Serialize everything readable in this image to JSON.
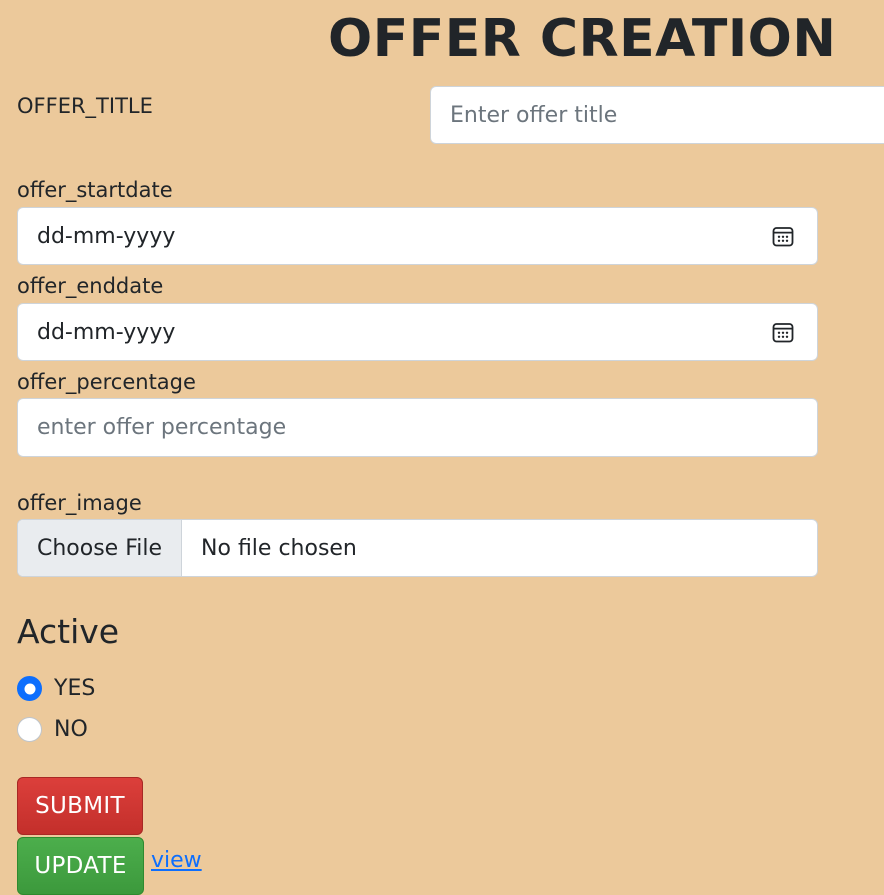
{
  "page": {
    "title": "OFFER CREATION"
  },
  "form": {
    "offer_title": {
      "label": "OFFER_TITLE",
      "placeholder": "Enter offer title",
      "value": ""
    },
    "offer_startdate": {
      "label": "offer_startdate",
      "value": "dd-mm-yyyy",
      "icon": "calendar-icon"
    },
    "offer_enddate": {
      "label": "offer_enddate",
      "value": "dd-mm-yyyy",
      "icon": "calendar-icon"
    },
    "offer_percentage": {
      "label": "offer_percentage",
      "placeholder": "enter offer percentage",
      "value": ""
    },
    "offer_image": {
      "label": "offer_image",
      "button_label": "Choose File",
      "status": "No file chosen"
    },
    "active": {
      "heading": "Active",
      "options": [
        {
          "label": "YES",
          "checked": true
        },
        {
          "label": "NO",
          "checked": false
        }
      ]
    },
    "actions": {
      "submit_label": "SUBMIT",
      "update_label": "UPDATE",
      "view_link": "view"
    }
  },
  "colors": {
    "page_background": "#ecc99b",
    "submit_button": "#d13a36",
    "update_button": "#44a444",
    "link": "#0d6efd",
    "radio_checked": "#0d6efd"
  }
}
